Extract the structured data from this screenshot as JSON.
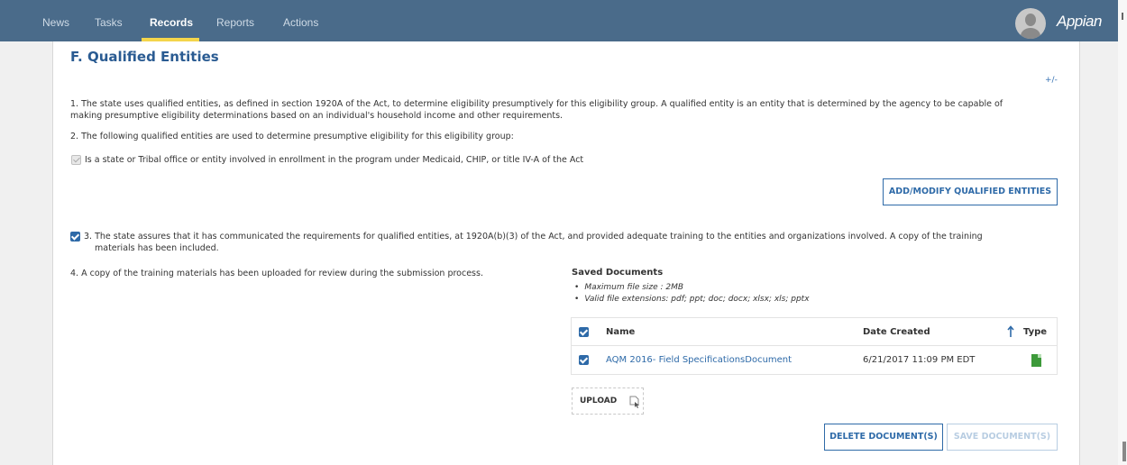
{
  "nav": {
    "items": [
      "News",
      "Tasks",
      "Records",
      "Reports",
      "Actions"
    ],
    "active": "Records",
    "brand": "Appian"
  },
  "section": {
    "title": "F. Qualified Entities",
    "toggle": "+/-",
    "p1_line1": "1. The state uses qualified entities, as defined in section 1920A of the Act, to determine eligibility presumptively for this eligibility group. A qualified entity is an entity that is determined by the agency to be capable of",
    "p1_line2": "making presumptive eligibility determinations based on an individual's household income and other requirements.",
    "p2": "2. The following qualified entities are used to determine presumptive eligibility for this eligibility group:",
    "entity_option": "Is a state or Tribal office or entity involved in enrollment in the program under Medicaid, CHIP, or title IV-A of the Act",
    "entity_checked": true,
    "add_modify_button": "ADD/MODIFY QUALIFIED ENTITIES",
    "p3_line1": "3. The state assures that it has communicated the requirements for qualified entities, at 1920A(b)(3) of the Act, and provided adequate training to the entities and organizations involved. A copy of the training",
    "p3_line2": "materials has been included.",
    "p3_checked": true,
    "p4": "4. A copy of the training materials has been uploaded for review during the submission process."
  },
  "documents": {
    "title": "Saved Documents",
    "rules": [
      "Maximum file size : 2MB",
      "Valid file extensions: pdf; ppt; doc; docx; xlsx; xls; pptx"
    ],
    "columns": {
      "name": "Name",
      "date": "Date Created",
      "type": "Type"
    },
    "rows": [
      {
        "name": "AQM 2016- Field SpecificationsDocument",
        "date": "6/21/2017 11:09 PM EDT",
        "type_icon": "xls-file-icon",
        "checked": true
      }
    ],
    "upload_label": "UPLOAD",
    "delete_button": "DELETE DOCUMENT(S)",
    "save_button": "SAVE DOCUMENT(S)"
  },
  "colors": {
    "nav_bg": "#4a6b8a",
    "accent": "#2e6aa8",
    "title": "#2a5b92",
    "active_underline": "#f4d54b",
    "xls_green": "#3d9a3a"
  }
}
